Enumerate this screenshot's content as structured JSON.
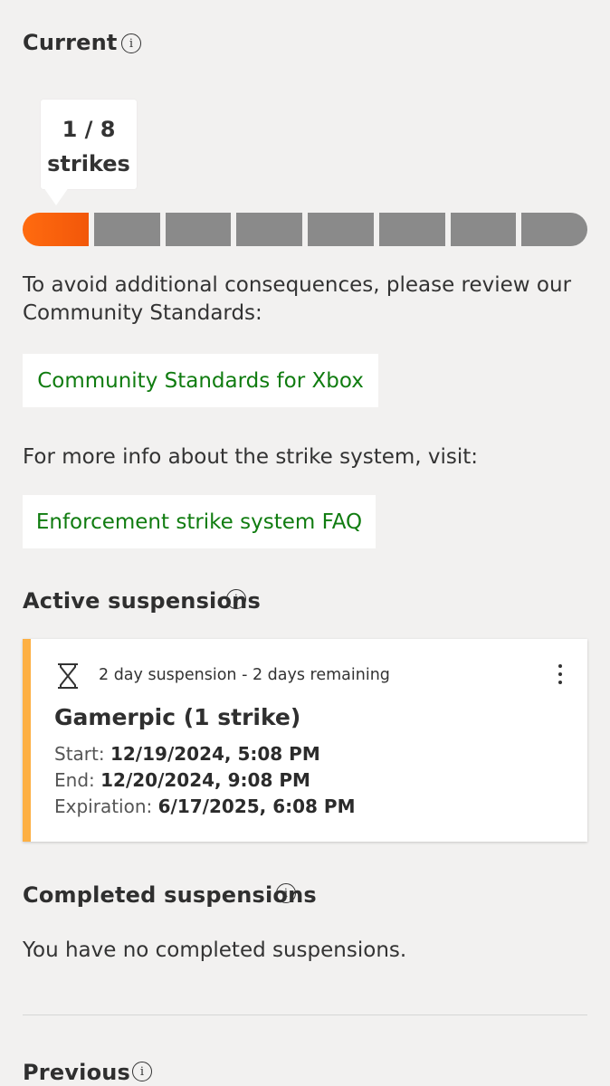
{
  "current": {
    "title": "Current",
    "tooltip_count": "1 / 8",
    "tooltip_unit": "strikes",
    "strikes": 1,
    "max_strikes": 8,
    "accent_color": "#f2570a"
  },
  "guidance": {
    "standards_text": "To avoid additional consequences, please review our Community Standards:",
    "standards_link": "Community Standards for Xbox",
    "faq_text": "For more info about the strike system, visit:",
    "faq_link": "Enforcement strike system FAQ",
    "link_color": "#107c10"
  },
  "active_suspensions": {
    "title": "Active suspensions",
    "items": [
      {
        "status": "2 day suspension - 2 days remaining",
        "title": "Gamerpic (1 strike)",
        "start_label": "Start:",
        "start_value": "12/19/2024, 5:08 PM",
        "end_label": "End:",
        "end_value": "12/20/2024, 9:08 PM",
        "expiration_label": "Expiration:",
        "expiration_value": "6/17/2025, 6:08 PM",
        "accent_color": "#fdb043",
        "icon": "hourglass-icon"
      }
    ]
  },
  "completed_suspensions": {
    "title": "Completed suspensions",
    "empty_text": "You have no completed suspensions."
  },
  "previous": {
    "title": "Previous"
  },
  "icons": {
    "info": "info-icon",
    "more": "more-options-icon"
  }
}
